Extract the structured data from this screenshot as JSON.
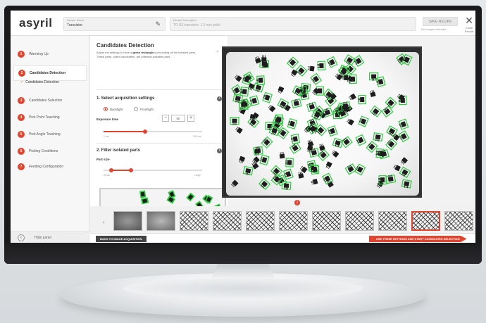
{
  "app": {
    "logo_text": "asyril",
    "brand_color": "#e2452f"
  },
  "header": {
    "recipe_field": {
      "label": "Recipe Name",
      "value": "Transistor"
    },
    "desc_field": {
      "label": "Recipe Description",
      "value": "TO-92 transistor, 1.2 mm pitch"
    },
    "save_as_label": "SAVE RECIPE",
    "no_image_note": "No images selected",
    "close_label": "Close Recipe"
  },
  "sidebar": {
    "steps": [
      {
        "num": "1",
        "label": "Warming Up"
      },
      {
        "num": "2",
        "label": "Candidates Detection"
      },
      {
        "num": "3",
        "label": "Candidates Selection"
      },
      {
        "num": "4",
        "label": "Pick Point Teaching"
      },
      {
        "num": "5",
        "label": "Pick Angle Teaching"
      },
      {
        "num": "6",
        "label": "Picking Conditions"
      },
      {
        "num": "7",
        "label": "Feeding Configuration"
      }
    ],
    "substep": "Candidates Detection",
    "hide_label": "Hide panel"
  },
  "panel": {
    "title": "Candidates Detection",
    "desc_1": "Adjust the settings to have a ",
    "desc_bold": "green rectangle",
    "desc_2": " surrounding all the isolated parts.",
    "desc_3": "These parts, called candidates, are potential pickable parts.",
    "section1": "1. Select acquisition settings",
    "radio_back": "Backlight",
    "radio_front": "Frontlight",
    "exposure_label": "Exposure time",
    "exposure_value": "50",
    "exposure_min": "1 ms",
    "exposure_max": "200 ms",
    "exposure_level": 0.42,
    "section2": "2. Filter isolated parts",
    "partsize_label": "Part size",
    "part_min": "Small",
    "part_max": "Large",
    "part_low": 0.08,
    "part_high": 0.28
  },
  "strip": {
    "selected_index": 9,
    "marker": "1"
  },
  "footer": {
    "back_label": "BACK TO IMAGE ACQUISITION",
    "go_label": "USE THESE SETTINGS AND START CANDIDATES SELECTION"
  }
}
